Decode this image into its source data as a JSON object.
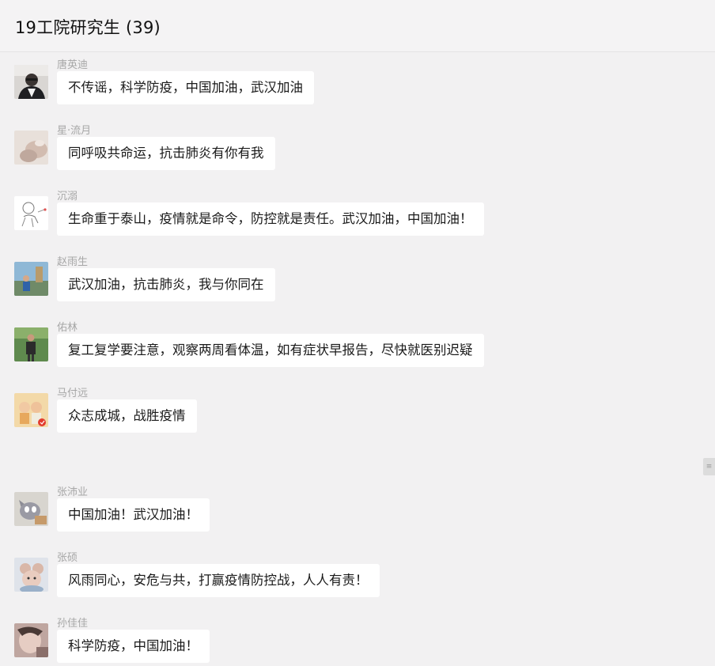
{
  "window": {
    "title": "19工院研究生 (39)"
  },
  "messages": [
    {
      "sender": "唐英迪",
      "text": "不传谣，科学防疫，中国加油，武汉加油",
      "avatar_icon": "profile-photo-icon"
    },
    {
      "sender": "星·流月",
      "text": "同呼吸共命运，抗击肺炎有你有我",
      "avatar_icon": "profile-photo-icon"
    },
    {
      "sender": "沉溺",
      "text": "生命重于泰山，疫情就是命令，防控就是责任。武汉加油，中国加油！",
      "avatar_icon": "sketch-avatar-icon"
    },
    {
      "sender": "赵雨生",
      "text": "武汉加油，抗击肺炎，我与你同在",
      "avatar_icon": "profile-photo-icon"
    },
    {
      "sender": "佑林",
      "text": "复工复学要注意，观察两周看体温，如有症状早报告，尽快就医别迟疑",
      "avatar_icon": "profile-photo-icon"
    },
    {
      "sender": "马付远",
      "text": "众志成城，战胜疫情",
      "avatar_icon": "profile-photo-icon"
    },
    {
      "sender": "张沛业",
      "text": "中国加油！武汉加油！",
      "avatar_icon": "cartoon-avatar-icon"
    },
    {
      "sender": "张硕",
      "text": "风雨同心，安危与共，打赢疫情防控战，人人有责！",
      "avatar_icon": "cartoon-avatar-icon"
    },
    {
      "sender": "孙佳佳",
      "text": "科学防疫，中国加油！",
      "avatar_icon": "profile-photo-icon"
    }
  ],
  "scroll_handle": {
    "icon": "side-tab-icon"
  }
}
